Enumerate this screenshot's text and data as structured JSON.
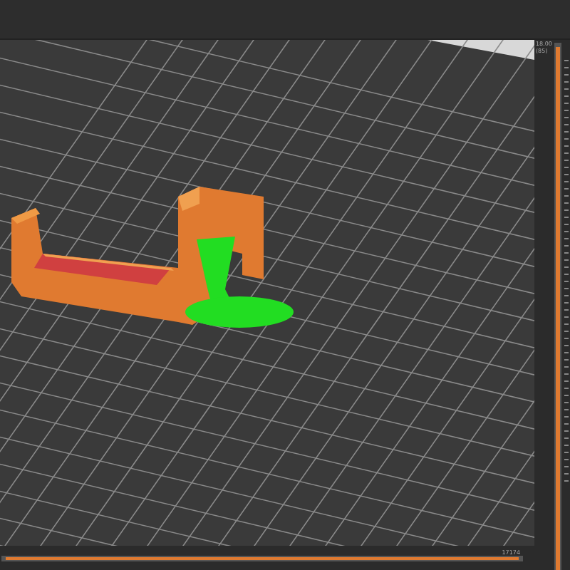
{
  "layer_slider": {
    "top_label": "18.00",
    "top_count": "(85)",
    "level": 1
  },
  "move_slider": {
    "label": "17174",
    "level": 1
  }
}
